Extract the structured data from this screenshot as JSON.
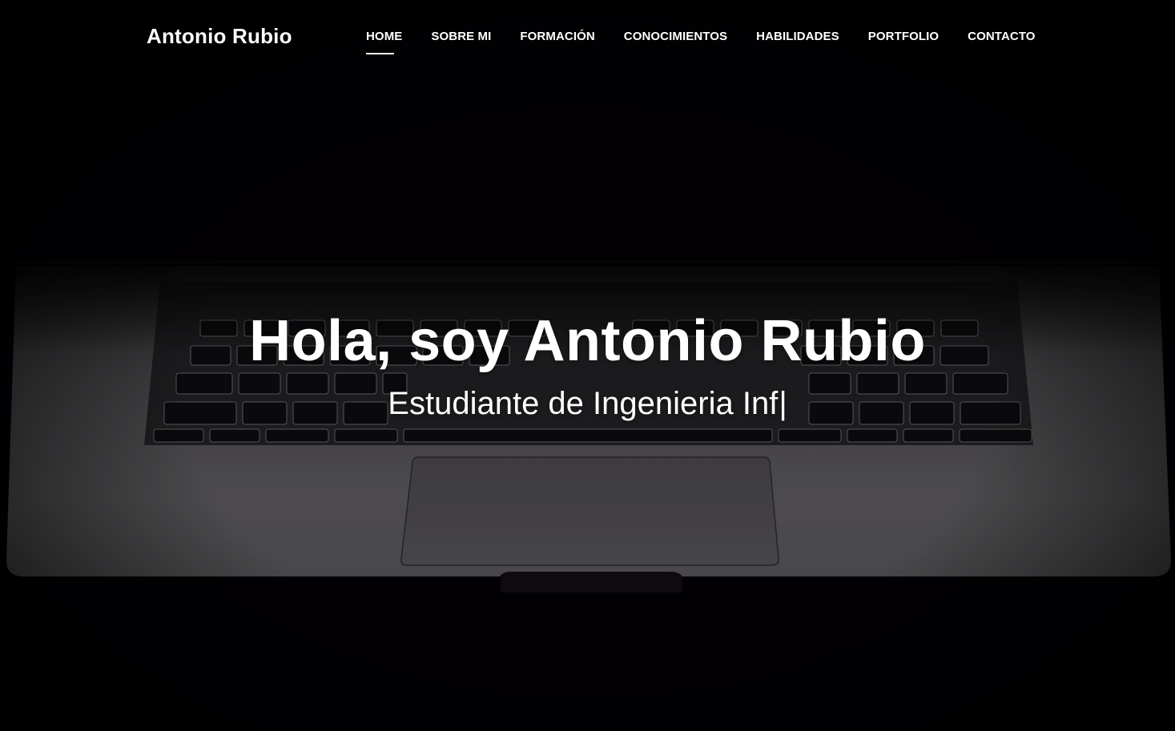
{
  "brand": {
    "name": "Antonio Rubio"
  },
  "nav": {
    "items": [
      {
        "label": "HOME",
        "active": true
      },
      {
        "label": "SOBRE MI",
        "active": false
      },
      {
        "label": "FORMACIÓN",
        "active": false
      },
      {
        "label": "CONOCIMIENTOS",
        "active": false
      },
      {
        "label": "HABILIDADES",
        "active": false
      },
      {
        "label": "PORTFOLIO",
        "active": false
      },
      {
        "label": "CONTACTO",
        "active": false
      }
    ]
  },
  "hero": {
    "title": "Hola, soy Antonio Rubio",
    "subtitle_typed": "Estudiante de Ingenieria Inf",
    "cursor": "|",
    "background_image": "laptop-keyboard-photo"
  },
  "colors": {
    "background": "#030105",
    "text": "#ffffff",
    "laptop_body": "#5a5859"
  }
}
